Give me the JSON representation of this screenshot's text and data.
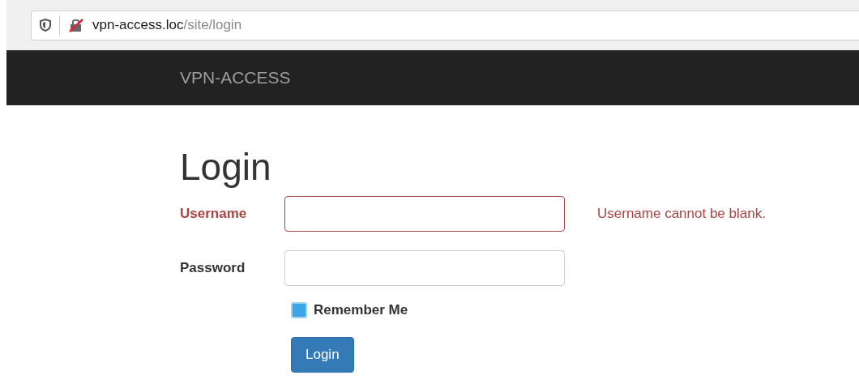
{
  "browser": {
    "url_host": "vpn-access.loc",
    "url_path": "/site/login"
  },
  "navbar": {
    "brand": "VPN-ACCESS"
  },
  "form": {
    "title": "Login",
    "fields": [
      {
        "label": "Username",
        "error": "Username cannot be blank.",
        "invalid": true
      },
      {
        "label": "Password",
        "invalid": false
      }
    ],
    "remember": {
      "label": "Remember Me",
      "checked": true
    },
    "submit": "Login"
  }
}
